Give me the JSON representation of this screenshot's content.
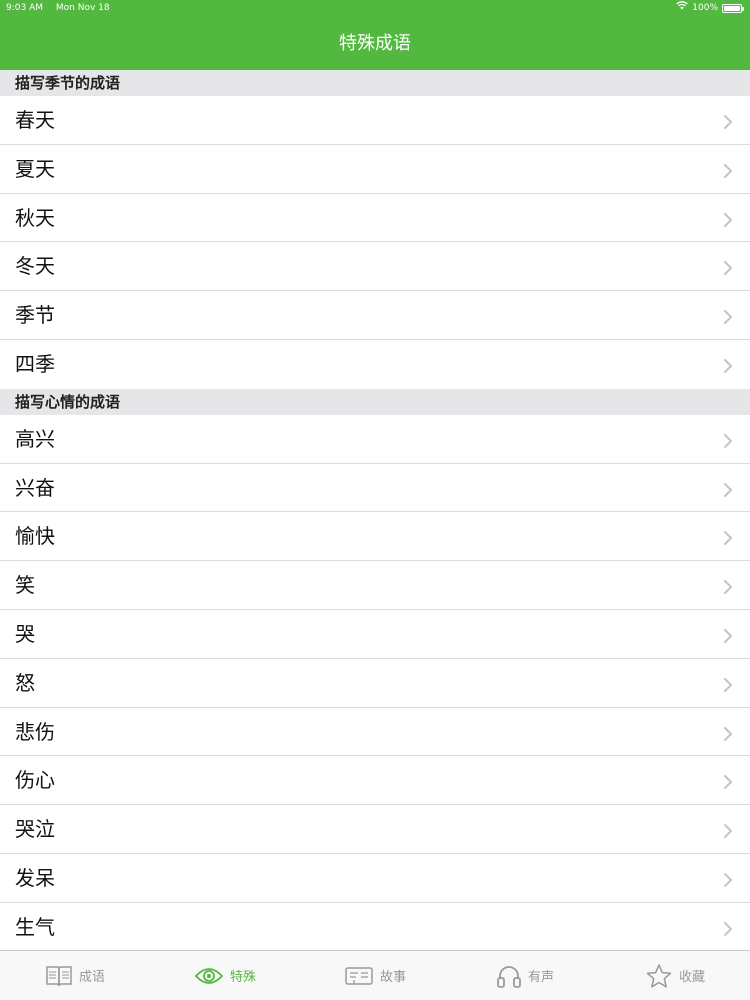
{
  "status_bar": {
    "time": "9:03 AM",
    "date": "Mon Nov 18",
    "battery": "100%",
    "battery_level": 1.0
  },
  "nav": {
    "title": "特殊成语"
  },
  "sections": [
    {
      "title": "描写季节的成语",
      "items": [
        "春天",
        "夏天",
        "秋天",
        "冬天",
        "季节",
        "四季"
      ]
    },
    {
      "title": "描写心情的成语",
      "items": [
        "高兴",
        "兴奋",
        "愉快",
        "笑",
        "哭",
        "怒",
        "悲伤",
        "伤心",
        "哭泣",
        "发呆",
        "生气"
      ]
    }
  ],
  "tabbar": {
    "active_color": "#53b840",
    "inactive_color": "#999999",
    "tabs": [
      {
        "label": "成语",
        "icon": "book-icon",
        "active": false
      },
      {
        "label": "特殊",
        "icon": "eye-icon",
        "active": true
      },
      {
        "label": "故事",
        "icon": "story-icon",
        "active": false
      },
      {
        "label": "有声",
        "icon": "headphones-icon",
        "active": false
      },
      {
        "label": "收藏",
        "icon": "star-icon",
        "active": false
      }
    ]
  },
  "colors": {
    "header": "#53b840",
    "section_bg": "#e6e6e8"
  }
}
